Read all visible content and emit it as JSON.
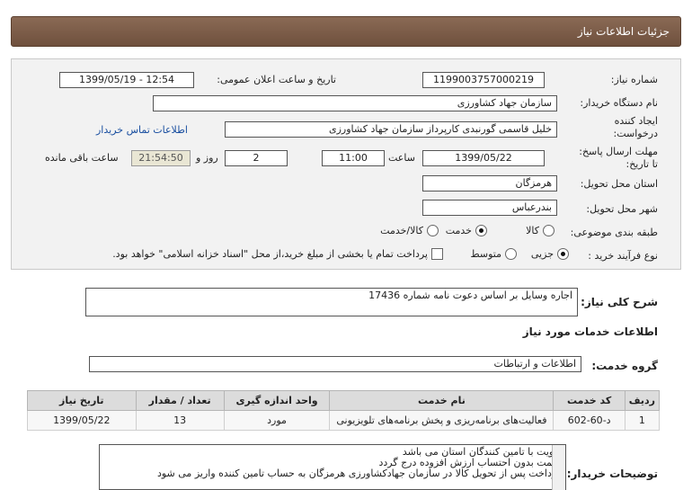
{
  "header": {
    "title": "جزئیات اطلاعات نیاز"
  },
  "form": {
    "need_number_label": "شماره نیاز:",
    "need_number": "1199003757000219",
    "announce_label": "تاریخ و ساعت اعلان عمومی:",
    "announce_value": "1399/05/19 - 12:54",
    "buyer_org_label": "نام دستگاه خریدار:",
    "buyer_org": "سازمان جهاد کشاورزی",
    "creator_label_1": "ایجاد کننده",
    "creator_label_2": "درخواست:",
    "creator": "خلیل قاسمی گورنبدی کارپرداز سازمان جهاد کشاورزی",
    "contact_link": "اطلاعات تماس خریدار",
    "deadline_label_1": "مهلت ارسال پاسخ:",
    "deadline_label_2": "تا تاریخ:",
    "deadline_date": "1399/05/22",
    "time_label": "ساعت",
    "deadline_time": "11:00",
    "days_value": "2",
    "days_label": "روز و",
    "remaining_time": "21:54:50",
    "remaining_label": "ساعت باقی مانده",
    "province_label": "استان محل تحویل:",
    "province": "هرمزگان",
    "city_label": "شهر محل تحویل:",
    "city": "بندرعباس",
    "category_label": "طبقه بندی موضوعی:",
    "category_options": [
      "کالا",
      "خدمت",
      "کالا/خدمت"
    ],
    "category_selected": "خدمت",
    "process_label": "نوع فرآیند خرید :",
    "process_options": [
      "جزیی",
      "متوسط"
    ],
    "process_selected": "جزیی",
    "payment_note": "پرداخت تمام یا بخشی از مبلغ خرید،از محل \"اسناد خزانه اسلامی\" خواهد بود."
  },
  "summary": {
    "label": "شرح کلی نیاز:",
    "value": "اجاره وسایل بر اساس دعوت نامه شماره 17436"
  },
  "services_section": {
    "title": "اطلاعات خدمات مورد نیاز",
    "group_label": "گروه خدمت:",
    "group_value": "اطلاعات و ارتباطات"
  },
  "table": {
    "headers": [
      "ردیف",
      "کد خدمت",
      "نام خدمت",
      "واحد اندازه گیری",
      "تعداد / مقدار",
      "تاریخ نیاز"
    ],
    "rows": [
      [
        "1",
        "د-60-602",
        "فعالیت‌های برنامه‌ریزی و پخش برنامه‌های تلویزیونی",
        "مورد",
        "13",
        "1399/05/22"
      ]
    ]
  },
  "notes": {
    "label": "توضیحات خریدار:",
    "lines": [
      "الویت با تامین کنندگان استان می باشد",
      "قیمت بدون احتساب ارزش افزوده درج گردد",
      "پرداخت پس از تحویل کالا در سازمان جهادکشاورزی هرمزگان  به حساب تامین کننده واریز می شود"
    ]
  }
}
